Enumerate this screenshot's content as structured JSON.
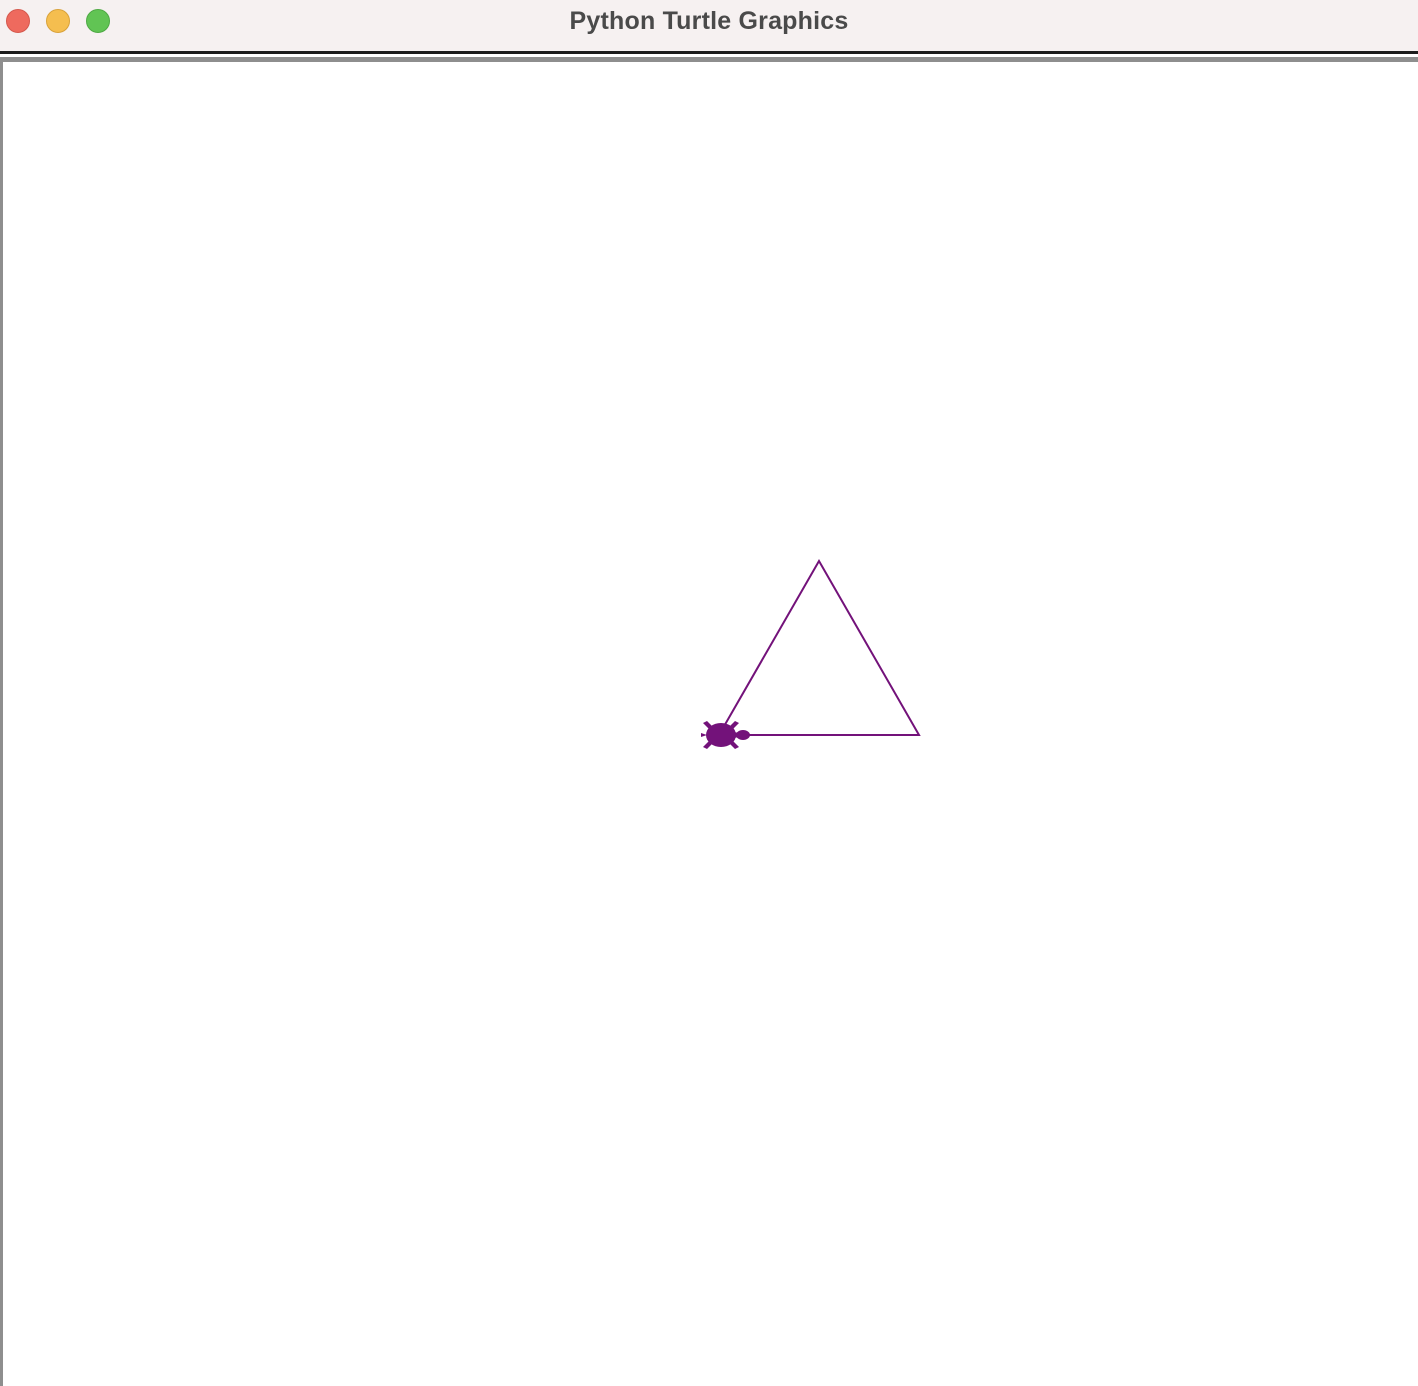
{
  "window": {
    "title": "Python Turtle Graphics",
    "controls": {
      "close": "close-button",
      "minimize": "minimize-button",
      "zoom": "zoom-button"
    }
  },
  "canvas": {
    "background": "#ffffff",
    "pen_color": "#73127a",
    "turtle_color": "#73127a",
    "turtle_shape": "turtle",
    "turtle_heading_deg": 0,
    "drawn_shape": "equilateral-triangle"
  }
}
